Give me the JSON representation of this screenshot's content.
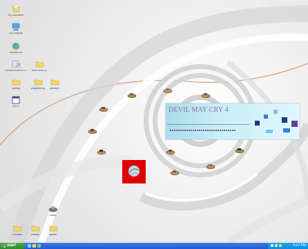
{
  "desktop": {
    "icons_left": [
      {
        "label": "My Documents",
        "icon": "folder-documents-icon"
      },
      {
        "label": "My Computer",
        "icon": "computer-icon"
      },
      {
        "label": "Network Set",
        "icon": "network-icon"
      },
      {
        "label": "Shortcut to Add or R...",
        "icon": "shortcut-icon"
      },
      {
        "label": "New Folder (2)",
        "icon": "folder-icon"
      },
      {
        "label": "Drawing",
        "icon": "folder-icon"
      },
      {
        "label": "programming",
        "icon": "folder-icon"
      },
      {
        "label": "desktops",
        "icon": "folder-icon"
      },
      {
        "label": "SeeYS",
        "icon": "application-icon"
      },
      {
        "label": "Buddy",
        "icon": "game-icon"
      },
      {
        "label": "Computer",
        "icon": "folder-icon"
      },
      {
        "label": "Desktop",
        "icon": "folder-icon"
      },
      {
        "label": "games",
        "icon": "folder-icon"
      }
    ]
  },
  "banner": {
    "title": "DEVIL MAY CRY 4",
    "colors": {
      "title": "#8b6da6",
      "squares_dark": "#1d3a7a",
      "squares_mid": "#3d7bd6",
      "squares_light": "#7fc1e8"
    }
  },
  "taskbar": {
    "start_label": "start",
    "clock": "5:07 PM",
    "colors": {
      "bar": "#2f6be0",
      "start": "#3f9b3b",
      "tray": "#14a0ea"
    }
  }
}
